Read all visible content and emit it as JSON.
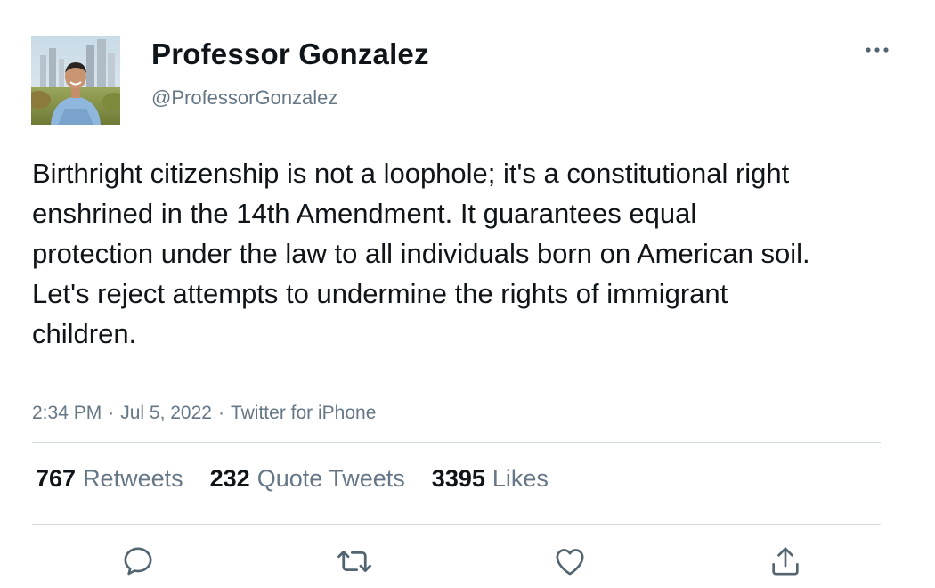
{
  "user": {
    "display_name": "Professor Gonzalez",
    "handle": "@ProfessorGonzalez"
  },
  "tweet": {
    "text": "Birthright citizenship is not a loophole; it's a constitutional right enshrined in the 14th Amendment. It guarantees equal protection under the law to all individuals born on American soil. Let's reject attempts to undermine the rights of immigrant children.",
    "time": "2:34 PM",
    "separator": "·",
    "date": "Jul 5, 2022",
    "source": "Twitter for iPhone"
  },
  "stats": {
    "retweets": {
      "count": "767",
      "label": "Retweets"
    },
    "quote_tweets": {
      "count": "232",
      "label": "Quote Tweets"
    },
    "likes": {
      "count": "3395",
      "label": "Likes"
    }
  },
  "icons": {
    "more": "more-horizontal-icon",
    "reply": "reply-icon",
    "retweet": "retweet-icon",
    "like": "heart-icon",
    "share": "share-icon"
  },
  "colors": {
    "text_primary": "#0f1419",
    "text_secondary": "#657786",
    "divider": "#cfd9de",
    "icon": "#536471"
  }
}
